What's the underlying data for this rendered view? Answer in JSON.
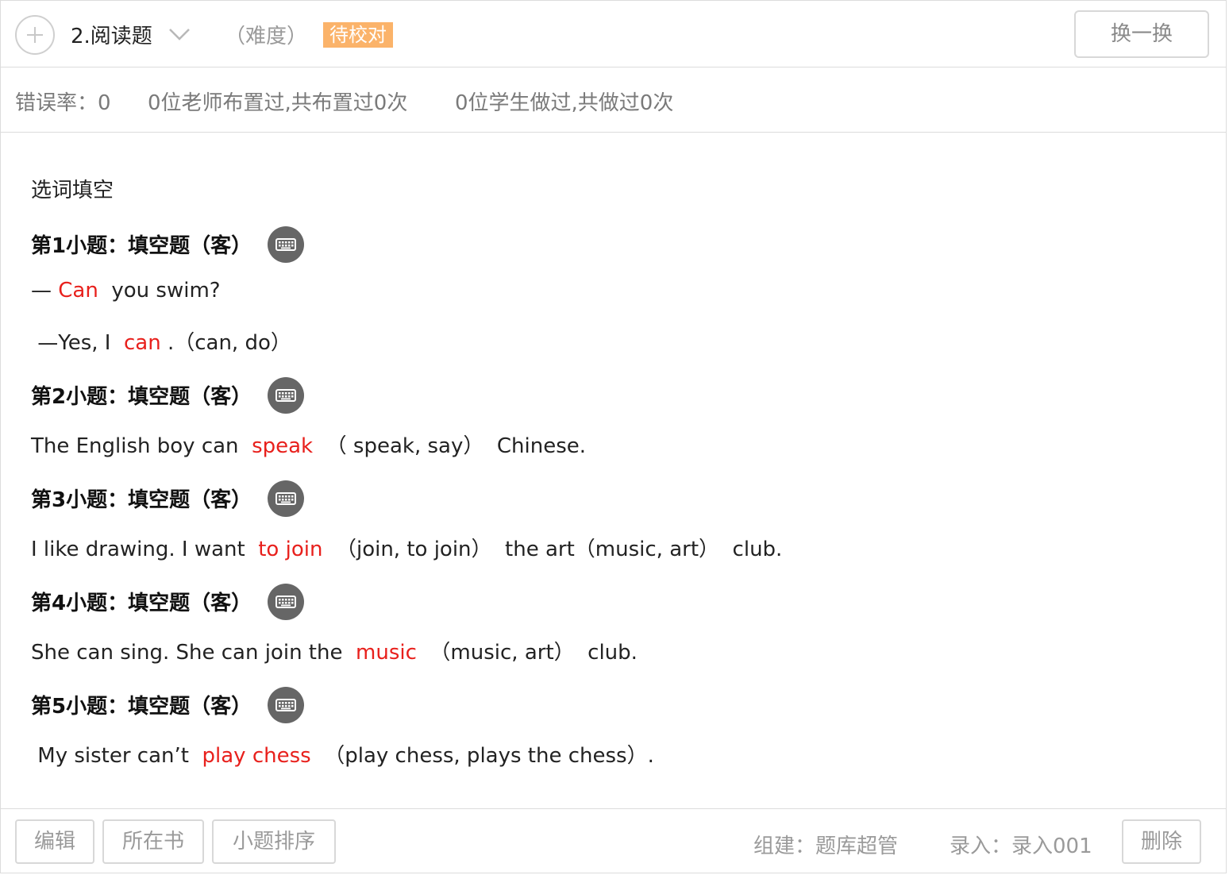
{
  "header": {
    "title": "2.阅读题",
    "difficulty": "（难度）",
    "status_badge": "待校对",
    "swap_label": "换一换"
  },
  "stats": {
    "error_rate": "错误率：0",
    "teachers": "0位老师布置过,共布置过0次",
    "students": "0位学生做过,共做过0次"
  },
  "body": {
    "intro": "选词填空",
    "questions": [
      {
        "heading": "第1小题：填空题（客）",
        "lines": [
          [
            "— ",
            "Can",
            "  you swim?"
          ],
          [
            " —Yes, I  ",
            "can",
            " .（can, do）"
          ]
        ]
      },
      {
        "heading": "第2小题：填空题（客）",
        "lines": [
          [
            "The English boy can  ",
            "speak",
            "  （ speak, say）  Chinese."
          ]
        ]
      },
      {
        "heading": "第3小题：填空题（客）",
        "lines": [
          [
            "I like drawing. I want  ",
            "to join",
            "  （join, to join）  the art（music, art）  club."
          ]
        ]
      },
      {
        "heading": "第4小题：填空题（客）",
        "lines": [
          [
            "She can sing. She can join the  ",
            "music",
            "  （music, art）  club."
          ]
        ]
      },
      {
        "heading": "第5小题：填空题（客）",
        "lines": [
          [
            " My sister can’t  ",
            "play chess",
            "  （play chess, plays the chess）."
          ]
        ]
      }
    ]
  },
  "footer": {
    "edit_label": "编辑",
    "book_label": "所在书",
    "sort_label": "小题排序",
    "builder": "组建：题库超管",
    "entry": "录入：录入001",
    "delete_label": "删除"
  },
  "colors": {
    "answer": "#e8201c",
    "badge": "#fbb36a",
    "icon_bg": "#666666"
  },
  "icons": [
    "plus-icon",
    "chevron-down-icon",
    "keyboard-icon"
  ]
}
